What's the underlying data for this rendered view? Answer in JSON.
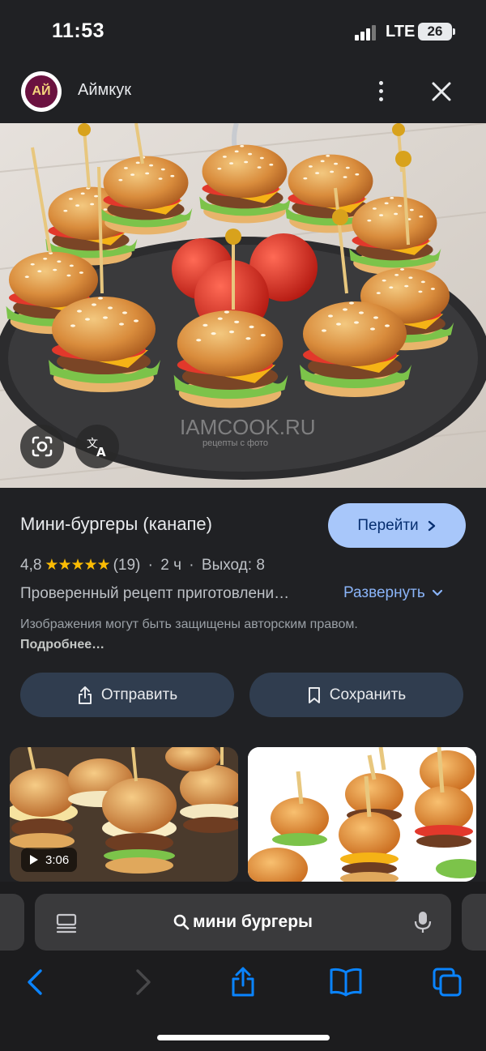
{
  "status_bar": {
    "time": "11:53",
    "network": "LTE",
    "battery": "26"
  },
  "source": {
    "logo_text": "АЙ",
    "name": "Аймкук"
  },
  "hero": {
    "watermark": "IAMCOOK.RU",
    "watermark_sub": "рецепты с фото"
  },
  "recipe": {
    "title": "Мини-бургеры (канапе)",
    "goto_label": "Перейти",
    "rating": "4,8",
    "stars": "★★★★★",
    "reviews": "(19)",
    "time": "2 ч",
    "yield": "Выход: 8",
    "description": "Проверенный рецепт приготовлени…",
    "expand_label": "Развернуть",
    "copyright_text": "Изображения могут быть защищены авторским правом.",
    "copyright_more": "Подробнее…"
  },
  "actions": {
    "share_label": "Отправить",
    "save_label": "Сохранить"
  },
  "related": [
    {
      "duration": "3:06"
    }
  ],
  "browser": {
    "search_query": "мини бургеры"
  },
  "colors": {
    "accent": "#a8c7fa",
    "link": "#8ab4f8",
    "stars": "#fbbc04",
    "background": "#202124"
  }
}
